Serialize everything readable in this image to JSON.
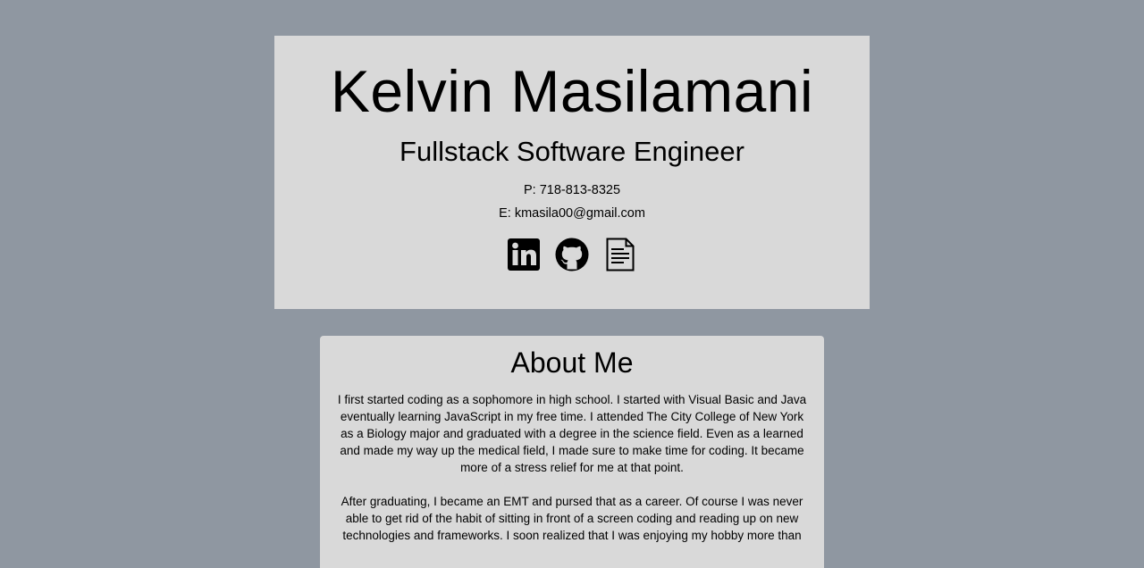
{
  "header": {
    "name": "Kelvin Masilamani",
    "role": "Fullstack Software Engineer",
    "phone": "P: 718-813-8325",
    "email": "E: kmasila00@gmail.com",
    "icons": [
      "linkedin-icon",
      "github-icon",
      "resume-document-icon"
    ]
  },
  "about": {
    "title": "About Me",
    "paragraph1": "I first started coding as a sophomore in high school. I started with Visual Basic and Java eventually learning JavaScript in my free time. I attended The City College of New York as a Biology major and graduated with a degree in the science field. Even as a learned and made my way up the medical field, I made sure to make time for coding. It became more of a stress relief for me at that point.",
    "paragraph2": "After graduating, I became an EMT and pursed that as a career. Of course I was never able to get rid of the habit of sitting in front of a screen coding and reading up on new technologies and frameworks. I soon realized that I was enjoying my hobby more than"
  },
  "colors": {
    "background": "#8f97a1",
    "card": "#d9d9d9",
    "text": "#000000"
  }
}
